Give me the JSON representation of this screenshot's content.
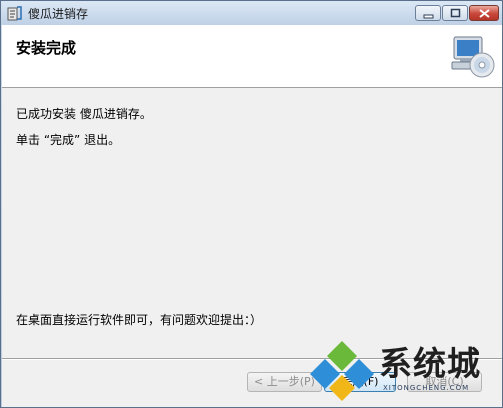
{
  "window": {
    "title": "傻瓜进销存",
    "header_title": "安装完成"
  },
  "body": {
    "line1": "已成功安装 傻瓜进销存。",
    "line2": "单击 “完成” 退出。",
    "line3": "在桌面直接运行软件即可，有问题欢迎提出：）"
  },
  "buttons": {
    "back": "< 上一步(P)",
    "finish": "完成(F)",
    "cancel": "取消(C)"
  },
  "watermark": {
    "text": "系统城",
    "url": "XITONGCHENG.COM"
  },
  "icons": {
    "app": "app-icon",
    "header": "computer-cd-icon"
  }
}
